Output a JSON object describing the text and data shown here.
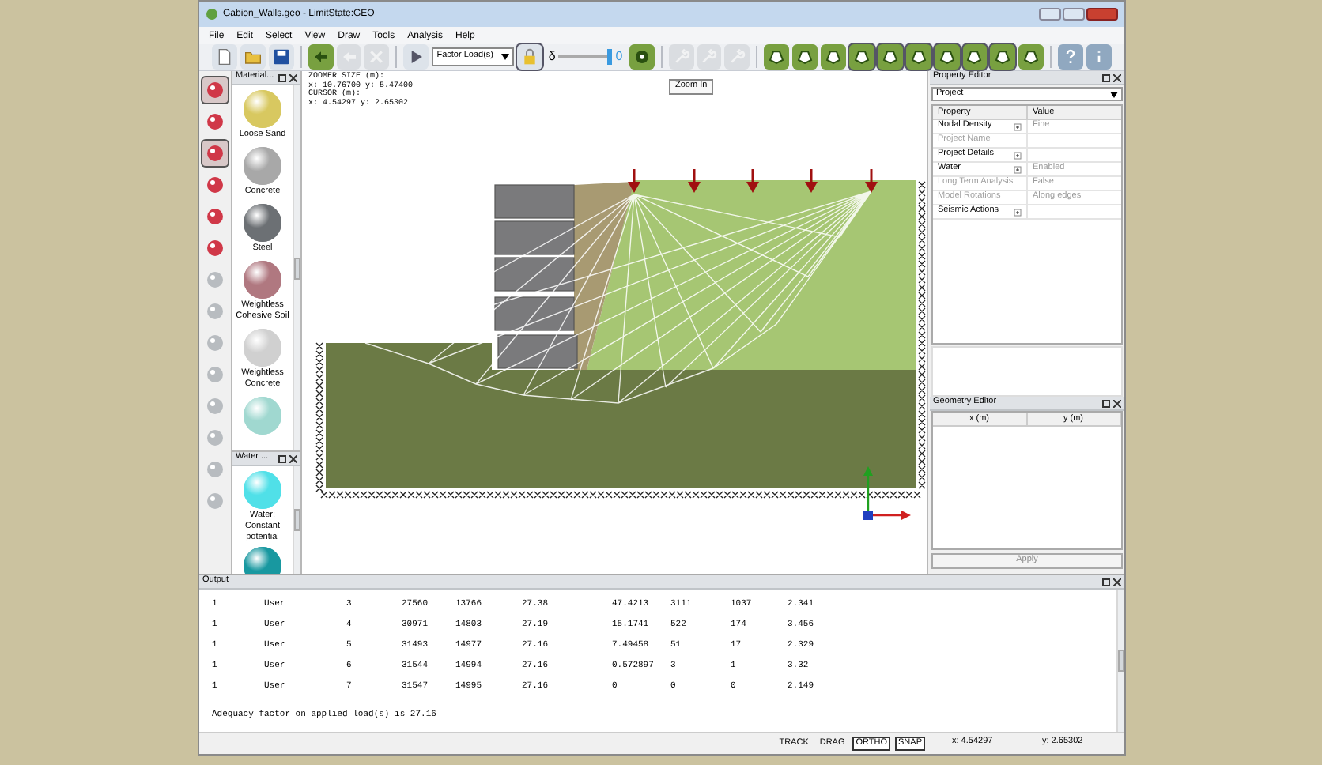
{
  "window": {
    "title": "Gabion_Walls.geo - LimitState:GEO"
  },
  "menu": [
    "File",
    "Edit",
    "Select",
    "View",
    "Draw",
    "Tools",
    "Analysis",
    "Help"
  ],
  "toolbar": [
    {
      "kind": "button",
      "disabled": false,
      "pressed": false
    },
    {
      "kind": "button",
      "disabled": false,
      "pressed": false
    },
    {
      "kind": "button",
      "disabled": false,
      "pressed": false
    },
    {
      "kind": "separator"
    },
    {
      "kind": "button",
      "disabled": false,
      "pressed": false
    },
    {
      "kind": "button",
      "disabled": true,
      "pressed": false
    },
    {
      "kind": "button",
      "disabled": true,
      "pressed": false
    },
    {
      "kind": "separator"
    },
    {
      "kind": "button",
      "disabled": false,
      "pressed": false
    },
    {
      "kind": "dropdown",
      "value": "Factor Load(s)"
    },
    {
      "kind": "button",
      "disabled": false,
      "pressed": true
    },
    {
      "kind": "slider",
      "label": "δ",
      "level": 1,
      "reading": "0"
    },
    {
      "kind": "button",
      "disabled": false,
      "pressed": false
    },
    {
      "kind": "separator"
    },
    {
      "kind": "button",
      "disabled": true,
      "pressed": false
    },
    {
      "kind": "button",
      "disabled": true,
      "pressed": false
    },
    {
      "kind": "button",
      "disabled": true,
      "pressed": false
    },
    {
      "kind": "separator"
    },
    {
      "kind": "button",
      "disabled": false,
      "pressed": false
    },
    {
      "kind": "button",
      "disabled": false,
      "pressed": false
    },
    {
      "kind": "button",
      "disabled": false,
      "pressed": false
    },
    {
      "kind": "button",
      "disabled": false,
      "pressed": true
    },
    {
      "kind": "button",
      "disabled": false,
      "pressed": true
    },
    {
      "kind": "button",
      "disabled": false,
      "pressed": true
    },
    {
      "kind": "button",
      "disabled": false,
      "pressed": true
    },
    {
      "kind": "button",
      "disabled": false,
      "pressed": true
    },
    {
      "kind": "button",
      "disabled": false,
      "pressed": true
    },
    {
      "kind": "button",
      "disabled": false,
      "pressed": false
    },
    {
      "kind": "separator"
    },
    {
      "kind": "button",
      "disabled": false,
      "pressed": false
    },
    {
      "kind": "button",
      "disabled": false,
      "pressed": false
    }
  ],
  "left_tools": [
    {
      "pressed": true,
      "disabled": false
    },
    {
      "pressed": false,
      "disabled": false
    },
    {
      "pressed": true,
      "disabled": false
    },
    {
      "pressed": false,
      "disabled": false
    },
    {
      "pressed": false,
      "disabled": false
    },
    {
      "pressed": false,
      "disabled": false
    },
    {
      "pressed": false,
      "disabled": true
    },
    {
      "pressed": false,
      "disabled": true
    },
    {
      "pressed": false,
      "disabled": true
    },
    {
      "pressed": false,
      "disabled": true
    },
    {
      "pressed": false,
      "disabled": true
    },
    {
      "pressed": false,
      "disabled": true
    },
    {
      "pressed": false,
      "disabled": true
    },
    {
      "pressed": false,
      "disabled": true
    }
  ],
  "materials_panel": {
    "title": "Material...",
    "items": [
      {
        "label": "Loose Sand",
        "color": "#d8c860"
      },
      {
        "label": "Concrete",
        "color": "#a8a8a8"
      },
      {
        "label": "Steel",
        "color": "#6c7074"
      },
      {
        "label": "Weightless Cohesive Soil",
        "color": "#b07880"
      },
      {
        "label": "Weightless Concrete",
        "color": "#d0d0d0"
      },
      {
        "color": "#a0d8d0"
      }
    ]
  },
  "water_panel": {
    "title": "Water ...",
    "items": [
      {
        "label": "Water: Constant potential",
        "color": "#50e0e8"
      },
      {
        "color": "#1898a0"
      }
    ]
  },
  "canvas": {
    "readout": [
      "ZOOMER SIZE (m):",
      "x: 10.76700 y: 5.47400",
      "CURSOR (m):",
      "x: 4.54297 y: 2.65302"
    ],
    "tooltip": "Zoom In"
  },
  "property_editor": {
    "title": "Property Editor",
    "selector": "Project",
    "columns": [
      "Property",
      "Value"
    ],
    "rows": [
      {
        "property": "Nodal Density",
        "value": "Fine",
        "expandable": true,
        "disabled": false
      },
      {
        "property": "Project Name",
        "expandable": false,
        "disabled": true
      },
      {
        "property": "Project Details",
        "expandable": true,
        "disabled": false
      },
      {
        "property": "Water",
        "value": "Enabled",
        "expandable": true,
        "disabled": false
      },
      {
        "property": "Long Term Analysis",
        "value": "False",
        "expandable": false,
        "disabled": true
      },
      {
        "property": "Model Rotations",
        "value": "Along edges",
        "expandable": false,
        "disabled": true
      },
      {
        "property": "Seismic Actions",
        "expandable": true,
        "disabled": false
      }
    ]
  },
  "geometry_editor": {
    "title": "Geometry Editor",
    "columns": [
      "x (m)",
      "y (m)"
    ],
    "button": "Apply"
  },
  "output": {
    "title": "Output",
    "rows": [
      [
        "1",
        "User",
        "3",
        "27560",
        "13766",
        "27.38",
        "47.4213",
        "3111",
        "1037",
        "2.341"
      ],
      [
        "1",
        "User",
        "4",
        "30971",
        "14803",
        "27.19",
        "15.1741",
        "522",
        "174",
        "3.456"
      ],
      [
        "1",
        "User",
        "5",
        "31493",
        "14977",
        "27.16",
        "7.49458",
        "51",
        "17",
        "2.329"
      ],
      [
        "1",
        "User",
        "6",
        "31544",
        "14994",
        "27.16",
        "0.572897",
        "3",
        "1",
        "3.32"
      ],
      [
        "1",
        "User",
        "7",
        "31547",
        "14995",
        "27.16",
        "0",
        "0",
        "0",
        "2.149"
      ]
    ],
    "summary": "Adequacy factor on applied load(s) is 27.16"
  },
  "status_bar": {
    "toggles": [
      {
        "label": "TRACK",
        "on": false
      },
      {
        "label": "DRAG",
        "on": false
      },
      {
        "label": "ORTHO",
        "on": true
      },
      {
        "label": "SNAP",
        "on": true
      }
    ],
    "coords": [
      "x: 4.54297",
      "y: 2.65302"
    ]
  }
}
